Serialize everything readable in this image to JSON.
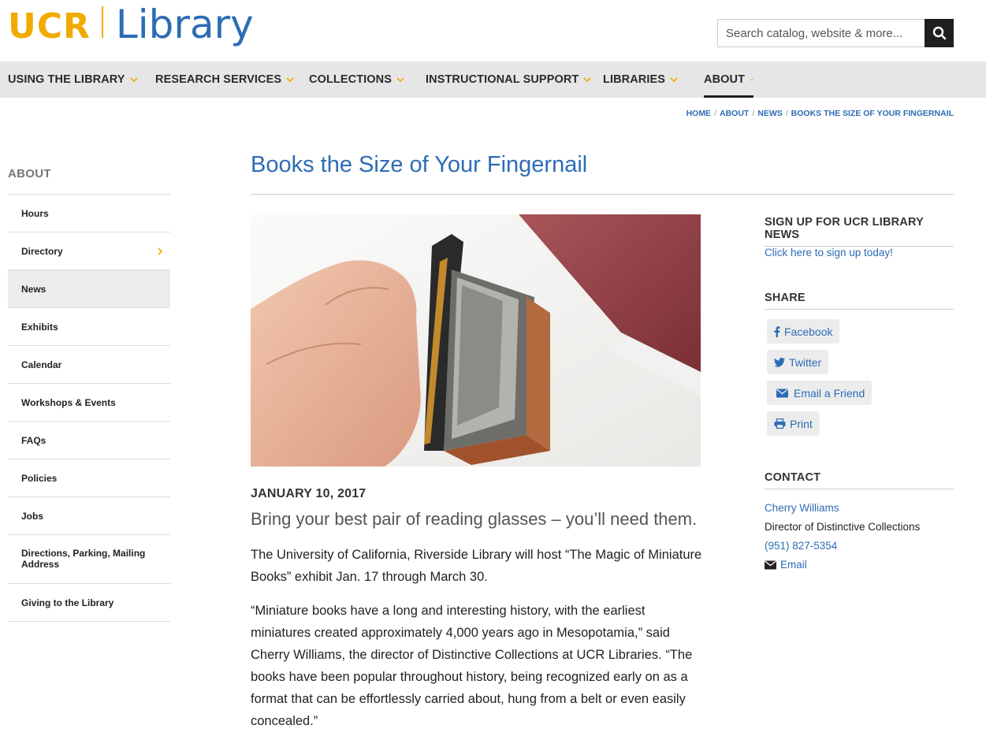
{
  "header": {
    "logo_ucr": "UCR",
    "logo_library": "Library",
    "search_placeholder": "Search catalog, website & more..."
  },
  "nav": {
    "items": [
      {
        "label": "USING THE LIBRARY"
      },
      {
        "label": "RESEARCH SERVICES"
      },
      {
        "label": "COLLECTIONS"
      },
      {
        "label": "INSTRUCTIONAL SUPPORT"
      },
      {
        "label": "LIBRARIES"
      },
      {
        "label": "ABOUT"
      }
    ],
    "active": "ABOUT"
  },
  "breadcrumb": {
    "home": "HOME",
    "about": "ABOUT",
    "news": "NEWS",
    "current": "BOOKS THE SIZE OF YOUR FINGERNAIL"
  },
  "sidebar": {
    "title": "ABOUT",
    "items": [
      {
        "label": "Hours"
      },
      {
        "label": "Directory"
      },
      {
        "label": "News"
      },
      {
        "label": "Exhibits"
      },
      {
        "label": "Calendar"
      },
      {
        "label": "Workshops & Events"
      },
      {
        "label": "FAQs"
      },
      {
        "label": "Policies"
      },
      {
        "label": "Jobs"
      },
      {
        "label": "Directions, Parking, Mailing Address"
      },
      {
        "label": "Giving to the Library"
      }
    ],
    "active": "News"
  },
  "article": {
    "title": "Books the Size of Your Fingernail",
    "date": "JANUARY 10, 2017",
    "lede": "Bring your best pair of reading glasses – you’ll need them.",
    "paragraphs": [
      "The University of California, Riverside Library will host “The Magic of Miniature Books” exhibit Jan. 17 through March 30.",
      "“Miniature books have a long and interesting history, with the earliest miniatures created approximately 4,000 years ago in Mesopotamia,” said Cherry Williams, the director of Distinctive Collections at UCR Libraries. “The books have been popular throughout history, being recognized early on as a format that can be effortlessly carried about, hung from a belt or even easily concealed.”"
    ]
  },
  "right": {
    "newsletter_heading": "SIGN UP FOR UCR LIBRARY NEWS",
    "newsletter_link": "Click here to sign up today!",
    "share_heading": "SHARE",
    "share": {
      "facebook": "Facebook",
      "twitter": "Twitter",
      "email": "Email a Friend",
      "print": "Print"
    },
    "contact_heading": "CONTACT",
    "contact": {
      "name": "Cherry Williams",
      "title": "Director of Distinctive Collections",
      "phone": "(951) 827-5354",
      "email": "Email"
    }
  },
  "colors": {
    "brand_gold": "#f1ab00",
    "brand_blue": "#2d6cb5",
    "nav_bg": "#e6e6e6"
  }
}
